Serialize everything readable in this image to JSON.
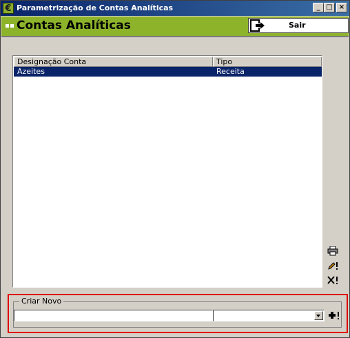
{
  "window": {
    "title": "Parametrização de Contas Analíticas",
    "app_icon_glyph": "€",
    "controls": {
      "minimize": "_",
      "maximize": "□",
      "close": "×"
    }
  },
  "header": {
    "title": "Contas Analíticas",
    "exit_label": "Sair",
    "exit_icon": "exit-door-icon"
  },
  "table": {
    "columns": [
      "Designação Conta",
      "Tipo"
    ],
    "rows": [
      {
        "designacao": "Azeites",
        "tipo": "Receita",
        "selected": true
      }
    ]
  },
  "side_actions": [
    {
      "name": "print",
      "icon": "printer-icon"
    },
    {
      "name": "edit",
      "icon": "edit-pencil-icon"
    },
    {
      "name": "delete",
      "icon": "delete-x-icon"
    }
  ],
  "criar_novo": {
    "label": "Criar Novo",
    "name_value": "",
    "type_value": "",
    "add_icon": "add-plus-icon"
  },
  "colors": {
    "title_bar": "#0a246a",
    "header_green": "#8db32b",
    "selection": "#0a246a",
    "highlight_border": "#e00000",
    "window_bg": "#d4d0c8"
  }
}
